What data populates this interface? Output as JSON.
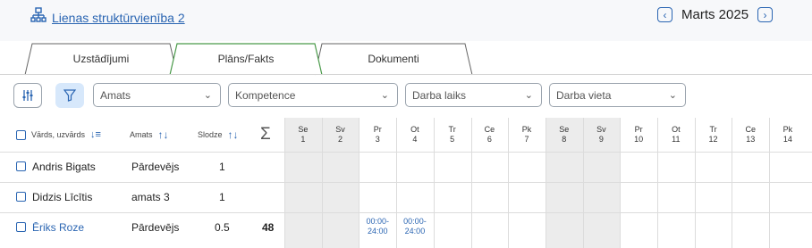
{
  "header": {
    "unit_link": "Lienas struktūrvienība 2",
    "month_prev_icon": "chevron-left-icon",
    "month_label": "Marts 2025",
    "month_next_icon": "chevron-right-icon"
  },
  "tabs": [
    {
      "label": "Uzstādījumi",
      "active": false
    },
    {
      "label": "Plāns/Fakts",
      "active": true
    },
    {
      "label": "Dokumenti",
      "active": false
    }
  ],
  "filters": {
    "columns_icon": "sliders-icon",
    "filter_icon": "funnel-icon",
    "amats": "Amats",
    "kompetence": "Kompetence",
    "darba_laiks": "Darba laiks",
    "darba_vieta": "Darba vieta"
  },
  "table": {
    "headers": {
      "name": "Vārds, uzvārds",
      "role": "Amats",
      "load": "Slodze",
      "sum": "Σ"
    },
    "days": [
      {
        "dow": "Se",
        "num": "1",
        "weekend": true
      },
      {
        "dow": "Sv",
        "num": "2",
        "weekend": true
      },
      {
        "dow": "Pr",
        "num": "3",
        "weekend": false
      },
      {
        "dow": "Ot",
        "num": "4",
        "weekend": false
      },
      {
        "dow": "Tr",
        "num": "5",
        "weekend": false
      },
      {
        "dow": "Ce",
        "num": "6",
        "weekend": false
      },
      {
        "dow": "Pk",
        "num": "7",
        "weekend": false
      },
      {
        "dow": "Se",
        "num": "8",
        "weekend": true
      },
      {
        "dow": "Sv",
        "num": "9",
        "weekend": true
      },
      {
        "dow": "Pr",
        "num": "10",
        "weekend": false
      },
      {
        "dow": "Ot",
        "num": "11",
        "weekend": false
      },
      {
        "dow": "Tr",
        "num": "12",
        "weekend": false
      },
      {
        "dow": "Ce",
        "num": "13",
        "weekend": false
      },
      {
        "dow": "Pk",
        "num": "14",
        "weekend": false
      }
    ],
    "rows": [
      {
        "name": "Andris Bigats",
        "role": "Pārdevējs",
        "load": "1",
        "sum": "",
        "link": false
      },
      {
        "name": "Didzis Līcītis",
        "role": "amats 3",
        "load": "1",
        "sum": "",
        "link": false
      },
      {
        "name": "Ēriks Roze",
        "role": "Pārdevējs",
        "load": "0.5",
        "sum": "48",
        "link": true
      }
    ],
    "shifts": [
      {
        "row": 2,
        "day": 2,
        "line1": "00:00-",
        "line2": "24:00"
      },
      {
        "row": 2,
        "day": 3,
        "line1": "00:00-",
        "line2": "24:00"
      }
    ]
  }
}
